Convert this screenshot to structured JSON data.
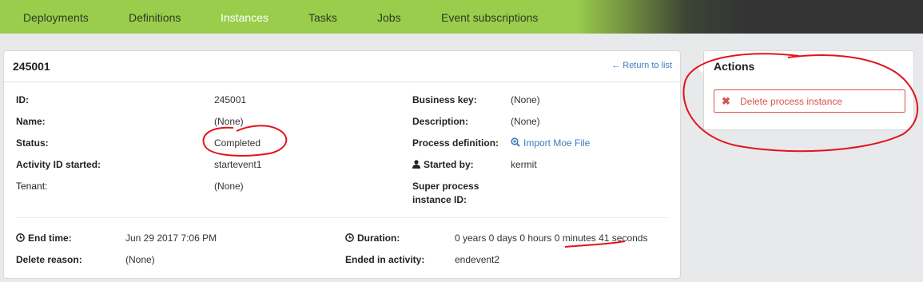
{
  "nav": {
    "tabs": [
      {
        "label": "Deployments"
      },
      {
        "label": "Definitions"
      },
      {
        "label": "Instances"
      },
      {
        "label": "Tasks"
      },
      {
        "label": "Jobs"
      },
      {
        "label": "Event subscriptions"
      }
    ],
    "active_tab": "Instances"
  },
  "instance": {
    "title": "245001",
    "return_link": "← Return to list",
    "fields": {
      "id": {
        "label": "ID:",
        "value": "245001"
      },
      "name": {
        "label": "Name:",
        "value": "(None)"
      },
      "status": {
        "label": "Status:",
        "value": "Completed"
      },
      "activity_started": {
        "label": "Activity ID started:",
        "value": "startevent1"
      },
      "tenant": {
        "label": "Tenant:",
        "value": "(None)"
      },
      "business_key": {
        "label": "Business key:",
        "value": "(None)"
      },
      "description": {
        "label": "Description:",
        "value": "(None)"
      },
      "process_definition": {
        "label": "Process definition:",
        "value": "Import Moe File"
      },
      "started_by": {
        "label": "Started by:",
        "value": "kermit"
      },
      "super_process": {
        "label_line1": "Super process",
        "label_line2": "instance ID:",
        "value": ""
      }
    },
    "end": {
      "end_time": {
        "label": "End time:",
        "value": "Jun 29 2017 7:06 PM"
      },
      "delete_reason": {
        "label": "Delete reason:",
        "value": "(None)"
      },
      "duration": {
        "label": "Duration:",
        "value": "0 years 0 days 0 hours 0 minutes 41 seconds"
      },
      "ended_in": {
        "label": "Ended in activity:",
        "value": "endevent2"
      }
    }
  },
  "actions": {
    "title": "Actions",
    "delete_label": "Delete process instance"
  },
  "colors": {
    "nav_green": "#9acd4c",
    "link_blue": "#3d7dc0",
    "danger_red": "#d9534f",
    "annotation_red": "#e0141e"
  },
  "icons": {
    "end_time": "clock-icon",
    "duration": "clock-icon",
    "process_definition": "magnifier-plus-icon",
    "started_by": "user-icon",
    "delete": "x-icon"
  }
}
